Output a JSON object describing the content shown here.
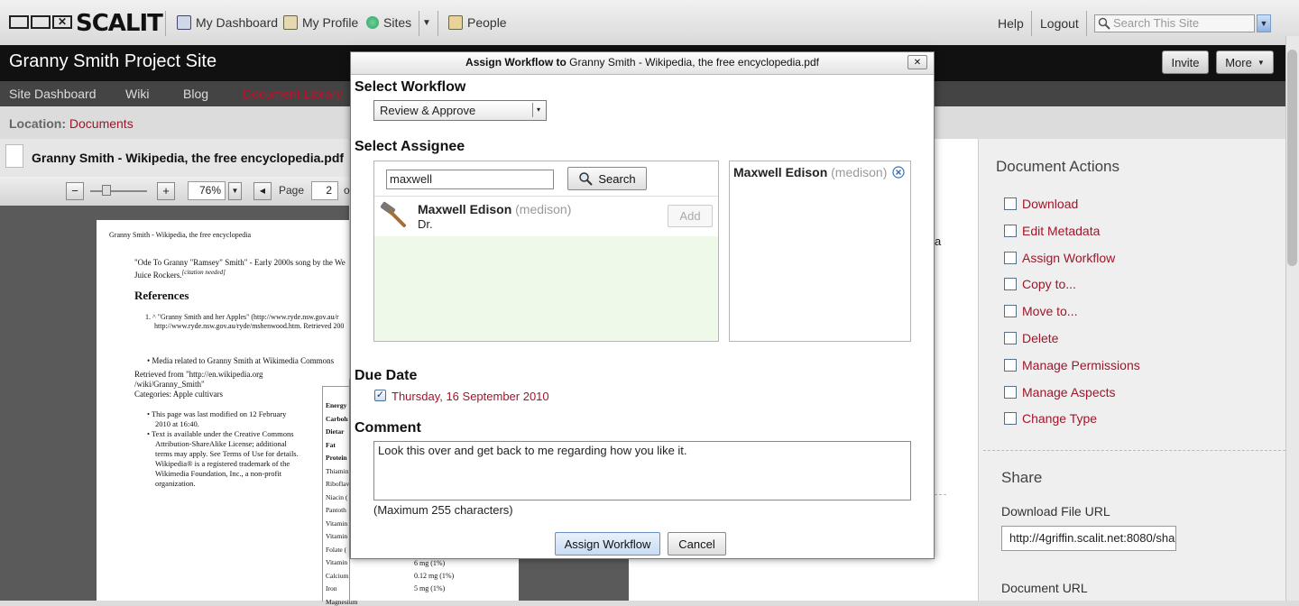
{
  "header": {
    "logo_text": "SCALIT",
    "nav": [
      "My Dashboard",
      "My Profile",
      "Sites",
      "People"
    ],
    "help": "Help",
    "logout": "Logout",
    "search_placeholder": "Search This Site"
  },
  "site": {
    "title": "Granny Smith Project Site",
    "invite": "Invite",
    "more": "More",
    "nav": [
      "Site Dashboard",
      "Wiki",
      "Blog",
      "Document Library"
    ],
    "location_label": "Location:",
    "location_value": "Documents"
  },
  "document": {
    "title": "Granny Smith - Wikipedia, the free encyclopedia.pdf",
    "zoom": "76%",
    "page_label": "Page",
    "page_value": "2",
    "page_of": "o"
  },
  "pdf": {
    "header": "Granny Smith - Wikipedia, the free encyclopedia",
    "line1": "\"Ode To Granny \"Ramsey\" Smith\" - Early 2000s song by the We",
    "line2": "Juice Rockers.",
    "cite": "[citation needed]",
    "references": "References",
    "ref1a": "1. ^ \"Granny Smith and her Apples\" (http://www.ryde.nsw.gov.au/r",
    "ref1b": "http://www.ryde.nsw.gov.au/ryde/mshenwood.htm. Retrieved 200",
    "media": "Media related to Granny Smith at Wikimedia Commons",
    "retrieved1": "Retrieved from \"http://en.wikipedia.org",
    "retrieved2": "/wiki/Granny_Smith\"",
    "categories": "Categories: Apple cultivars",
    "b1a": "This page was last modified on 12 February",
    "b1b": "2010 at 16:40.",
    "b2a": "Text is available under the Creative Commons",
    "b2b": "Attribution-ShareAlike License; additional",
    "b2c": "terms may apply. See Terms of Use for details.",
    "b2d": "Wikipedia® is a registered trademark of the",
    "b2e": "Wikimedia Foundation, Inc., a non-profit",
    "b2f": "organization.",
    "table_rows": [
      "Energy",
      "Carboh",
      "Dietar",
      "Fat",
      "Protein",
      "Thiamin",
      "Riboflav",
      "Niacin (",
      "Pantoth",
      "Vitamin",
      "Vitamin",
      "Folate (",
      "Vitamin",
      "Calcium",
      "Iron",
      "Magnesium"
    ],
    "table_vals": [
      "6 mg (1%)",
      "0.12 mg (1%)",
      "5 mg (1%)"
    ]
  },
  "dialog": {
    "title_bold": "Assign Workflow to",
    "title_rest": "Granny Smith - Wikipedia, the free encyclopedia.pdf",
    "close": "✕",
    "select_workflow": "Select Workflow",
    "workflow_value": "Review & Approve",
    "select_assignee": "Select Assignee",
    "search_value": "maxwell",
    "search_button": "Search",
    "result_name": "Maxwell Edison",
    "result_user": "(medison)",
    "result_title": "Dr.",
    "add_button": "Add",
    "selected_name": "Maxwell Edison",
    "selected_user": "(medison)",
    "due_date_label": "Due Date",
    "due_date_value": "Thursday, 16 September 2010",
    "comment_label": "Comment",
    "comment_value": "Look this over and get back to me regarding how you like it.",
    "max_chars": "(Maximum 255 characters)",
    "assign_button": "Assign Workflow",
    "cancel_button": "Cancel"
  },
  "middle_fragment": "a",
  "actions": {
    "title": "Document Actions",
    "items": [
      "Download",
      "Edit Metadata",
      "Assign Workflow",
      "Copy to...",
      "Move to...",
      "Delete",
      "Manage Permissions",
      "Manage Aspects",
      "Change Type"
    ],
    "share_title": "Share",
    "download_url_label": "Download File URL",
    "download_url_value": "http://4griffin.scalit.net:8080/sha",
    "document_url_label": "Document URL"
  },
  "colors": {
    "accent": "#a0152a",
    "dark_header": "#111111",
    "nav": "#444444"
  }
}
